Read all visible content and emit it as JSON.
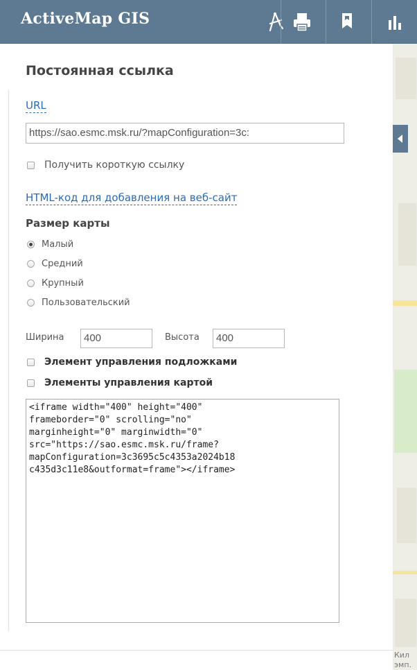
{
  "header": {
    "title": "ActiveMap GIS",
    "tools": [
      {
        "icon": "measure-compass-icon"
      },
      {
        "icon": "print-icon"
      },
      {
        "icon": "share-bookmark-icon"
      },
      {
        "icon": "bar-chart-icon"
      }
    ]
  },
  "permalink": {
    "heading": "Постоянная ссылка",
    "url_link": "URL",
    "url_value": "https://sao.esmc.msk.ru/?mapConfiguration=3c:",
    "short_link_label": "Получить короткую ссылку",
    "html_link": "HTML-код для добавления на веб-сайт",
    "map_size_label": "Размер карты",
    "sizes": [
      "Малый",
      "Средний",
      "Крупный",
      "Пользовательский"
    ],
    "selected_size": "Малый",
    "width_label": "Ширина",
    "width_value": "400",
    "height_label": "Высота",
    "height_value": "400",
    "basemap_control_label": "Элемент управления подложками",
    "map_controls_label": "Элементы управления картой",
    "embed_code": "<iframe width=\"400\" height=\"400\"\nframeborder=\"0\" scrolling=\"no\"\nmarginheight=\"0\" marginwidth=\"0\"\nsrc=\"https://sao.esmc.msk.ru/frame?\nmapConfiguration=3c3695c5c4353a2024b18\nc435d3c11e8&outformat=frame\"></iframe>"
  },
  "map": {
    "attribution_1": "Кил",
    "attribution_2": "эмп."
  },
  "colors": {
    "header_bg": "#5d7a92",
    "link": "#2a6bb8"
  }
}
